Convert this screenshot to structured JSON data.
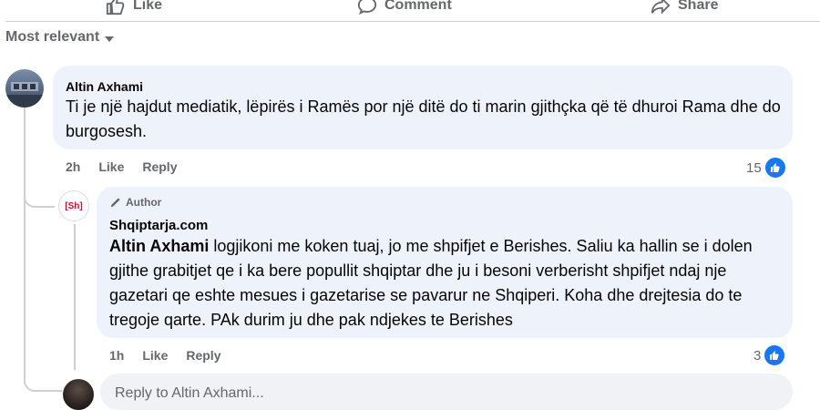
{
  "action_bar": {
    "like_label": "Like",
    "comment_label": "Comment",
    "share_label": "Share"
  },
  "sort": {
    "label": "Most relevant"
  },
  "comment": {
    "author": "Altin Axhami",
    "text": "Ti je një hajdut mediatik, lëpirës i Ramës por një ditë do ti marin gjithçka që të dhuroi Rama dhe do burgosesh.",
    "time": "2h",
    "like_label": "Like",
    "reply_label": "Reply",
    "reaction_count": "15"
  },
  "reply": {
    "badge": "Author",
    "author": "Shqiptarja.com",
    "avatar_text": "[Sh]",
    "mention": "Altin Axhami",
    "text": " logjikoni me koken tuaj, jo me shpifjet e Berishes. Saliu ka hallin se i dolen gjithe grabitjet qe i ka bere popullit shqiptar dhe ju i besoni verberisht shpifjet ndaj nje gazetari qe eshte mesues i gazetarise se pavarur ne Shqiperi. Koha dhe drejtesia do te tregoje qarte. PAk durim ju dhe pak ndjekes te Berishes",
    "time": "1h",
    "like_label": "Like",
    "reply_label": "Reply",
    "reaction_count": "3"
  },
  "reply_input": {
    "placeholder": "Reply to Altin Axhami..."
  },
  "colors": {
    "accent": "#1877f2",
    "bubble": "#eef3fb",
    "secondary_text": "#65676b"
  }
}
